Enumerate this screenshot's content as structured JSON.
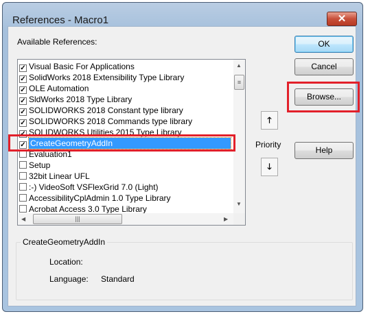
{
  "window": {
    "title": "References - Macro1",
    "close_icon": "close-icon"
  },
  "available_label": "Available References:",
  "references": [
    {
      "label": "Visual Basic For Applications",
      "checked": true
    },
    {
      "label": "SolidWorks 2018 Extensibility Type Library",
      "checked": true
    },
    {
      "label": "OLE Automation",
      "checked": true
    },
    {
      "label": "SldWorks 2018 Type Library",
      "checked": true
    },
    {
      "label": "SOLIDWORKS 2018 Constant type library",
      "checked": true
    },
    {
      "label": "SOLIDWORKS 2018 Commands type library",
      "checked": true
    },
    {
      "label": "SOLIDWORKS Utilities 2015 Type Library",
      "checked": true
    },
    {
      "label": "CreateGeometryAddIn",
      "checked": true,
      "selected": true
    },
    {
      "label": "Evaluation1",
      "checked": false
    },
    {
      "label": "Setup",
      "checked": false
    },
    {
      "label": "32bit Linear UFL",
      "checked": false
    },
    {
      "label": ":-) VideoSoft VSFlexGrid 7.0 (Light)",
      "checked": false
    },
    {
      "label": "AccessibilityCplAdmin 1.0 Type Library",
      "checked": false
    },
    {
      "label": "Acrobat Access 3.0 Type Library",
      "checked": false
    }
  ],
  "buttons": {
    "ok": "OK",
    "cancel": "Cancel",
    "browse": "Browse...",
    "help": "Help"
  },
  "priority_label": "Priority",
  "details": {
    "title": "CreateGeometryAddIn",
    "location_label": "Location:",
    "location_value": "",
    "language_label": "Language:",
    "language_value": "Standard"
  },
  "highlight_color": "#e2202a"
}
